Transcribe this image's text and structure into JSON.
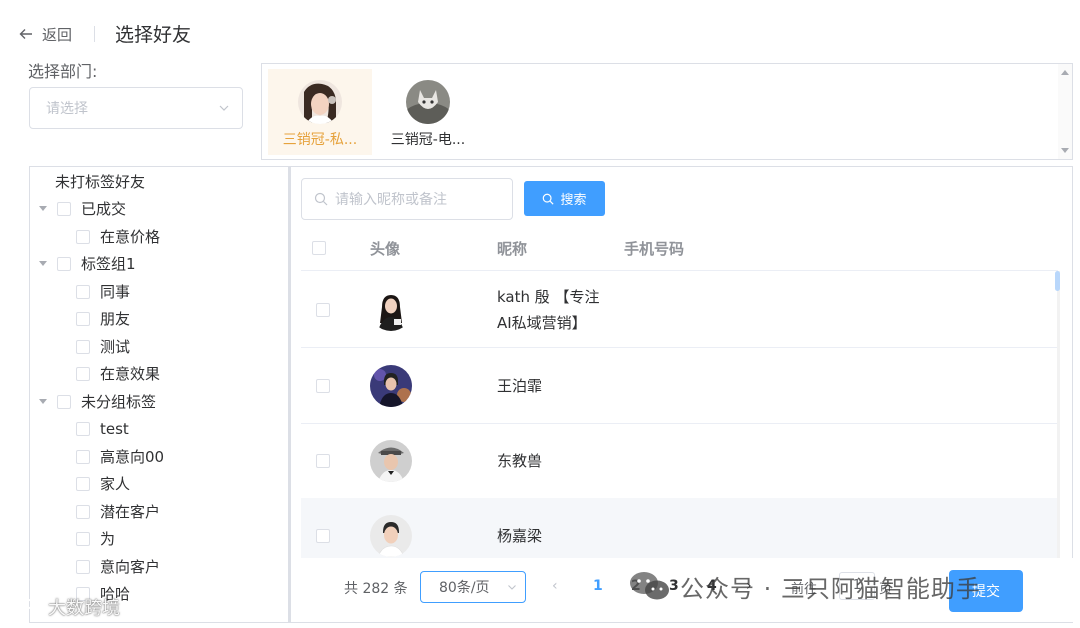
{
  "header": {
    "back_label": "返回",
    "title": "选择好友"
  },
  "department": {
    "label": "选择部门:",
    "placeholder": "请选择"
  },
  "selected_friends": [
    {
      "name": "三销冠-私...",
      "active": true
    },
    {
      "name": "三销冠-电...",
      "active": false
    }
  ],
  "tree": {
    "untagged": "未打标签好友",
    "groups": [
      {
        "label": "已成交",
        "children": [
          "在意价格"
        ]
      },
      {
        "label": "标签组1",
        "children": [
          "同事",
          "朋友",
          "测试",
          "在意效果"
        ]
      },
      {
        "label": "未分组标签",
        "children": [
          "test",
          "高意向00",
          "家人",
          "潜在客户",
          "为",
          "意向客户",
          "哈哈"
        ]
      }
    ]
  },
  "search": {
    "placeholder": "请输入昵称或备注",
    "button_label": "搜索"
  },
  "table": {
    "columns": [
      "头像",
      "昵称",
      "手机号码"
    ],
    "rows": [
      {
        "nickname_line1": "kath 殷 【专注",
        "nickname_line2": "AI私域营销】",
        "phone": ""
      },
      {
        "nickname": "王泊霏",
        "phone": ""
      },
      {
        "nickname": "东教兽",
        "phone": ""
      },
      {
        "nickname": "杨嘉梁",
        "phone": ""
      }
    ]
  },
  "pagination": {
    "total": "共 282 条",
    "page_size": "80条/页",
    "prev": "‹",
    "pages": [
      "1",
      "2",
      "3",
      "4"
    ],
    "current": "1",
    "next": "›",
    "goto_label": "前往",
    "goto_value": "1",
    "page_suffix": "页",
    "submit_label": "提交"
  },
  "watermarks": {
    "right": "公众号 · 三只阿猫智能助手",
    "left": "大数跨境"
  },
  "colors": {
    "primary": "#409eff",
    "active_card_bg": "#fdf6ec",
    "active_card_text": "#e6a23c"
  }
}
